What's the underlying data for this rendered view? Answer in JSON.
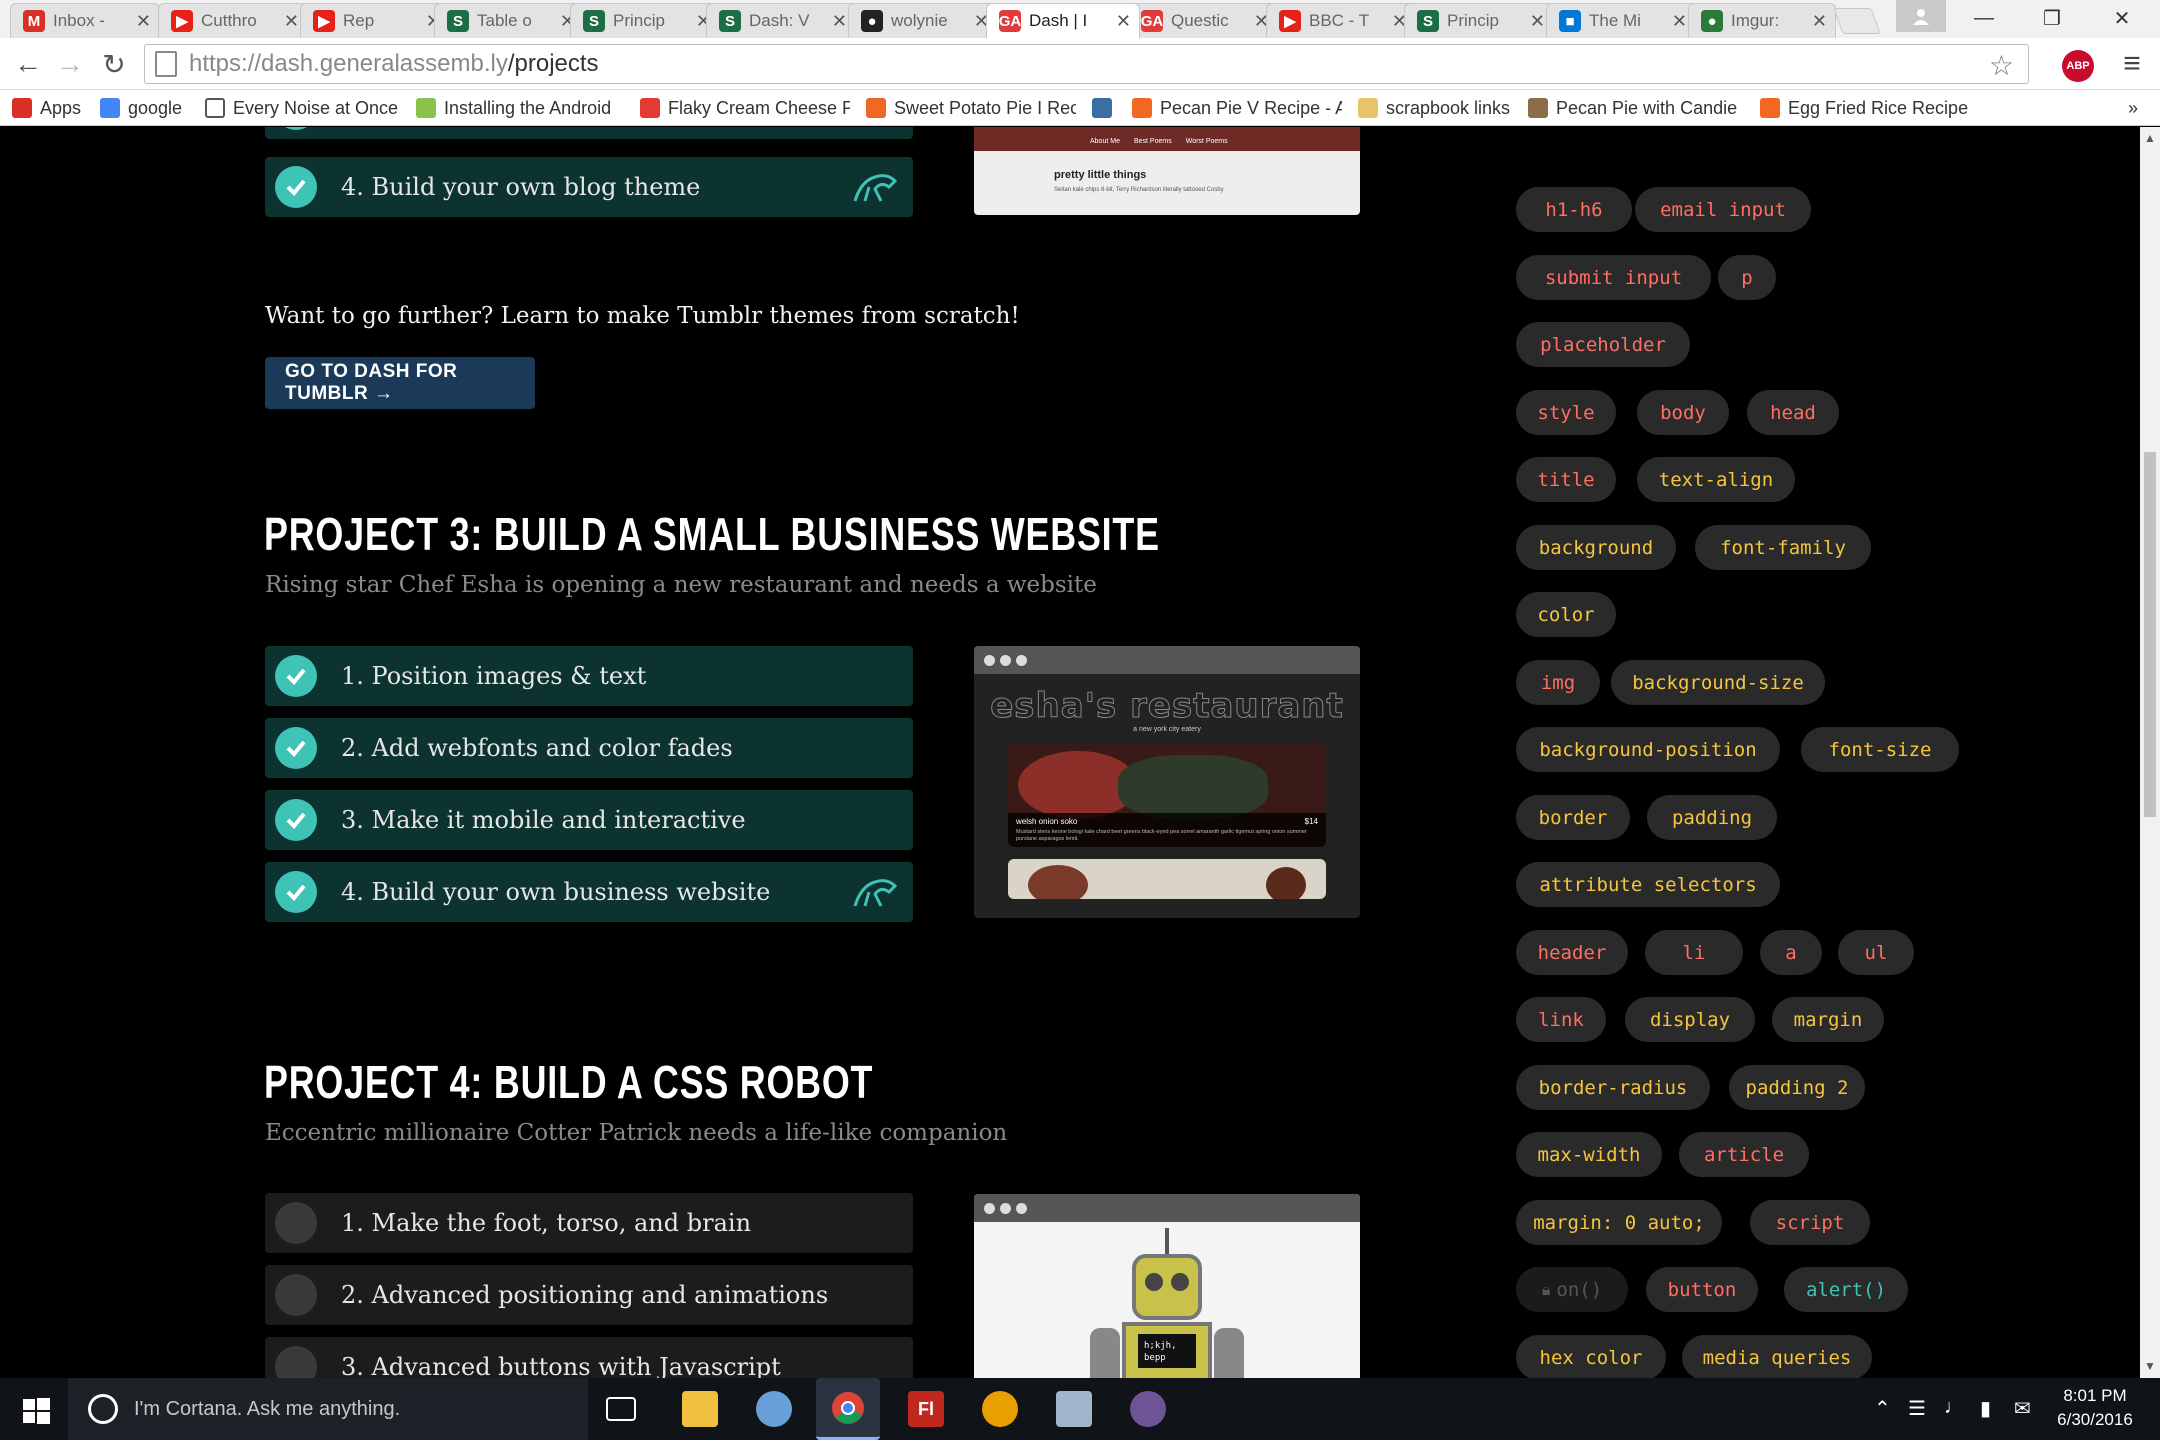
{
  "browser": {
    "tabs": [
      {
        "title": "Inbox -",
        "icon": "gmail-icon",
        "color": "#d93025",
        "glyph": "M"
      },
      {
        "title": "Cutthro",
        "icon": "youtube-icon",
        "color": "#e62117",
        "glyph": "▶"
      },
      {
        "title": "Rep",
        "icon": "youtube-icon",
        "color": "#e62117",
        "glyph": "▶"
      },
      {
        "title": "Table o",
        "icon": "sheets-icon",
        "color": "#1e6e45",
        "glyph": "S"
      },
      {
        "title": "Princip",
        "icon": "sheets-icon",
        "color": "#1e6e45",
        "glyph": "S"
      },
      {
        "title": "Dash: V",
        "icon": "sheets-icon",
        "color": "#1e6e45",
        "glyph": "S"
      },
      {
        "title": "wolynie",
        "icon": "github-icon",
        "color": "#222222",
        "glyph": "●"
      },
      {
        "title": "Dash | I",
        "icon": "ga-icon",
        "color": "#e23b3b",
        "glyph": "GA",
        "active": true
      },
      {
        "title": "Questic",
        "icon": "ga-icon",
        "color": "#e23b3b",
        "glyph": "GA"
      },
      {
        "title": "BBC - T",
        "icon": "youtube-icon",
        "color": "#e62117",
        "glyph": "▶"
      },
      {
        "title": "Princip",
        "icon": "sheets-icon",
        "color": "#1e6e45",
        "glyph": "S"
      },
      {
        "title": "The Mi",
        "icon": "windows-icon",
        "color": "#0078d7",
        "glyph": "■"
      },
      {
        "title": "Imgur:",
        "icon": "imgur-icon",
        "color": "#2b7a3a",
        "glyph": "●"
      }
    ],
    "url_host": "https://dash.generalassemb.ly",
    "url_path": "/projects",
    "bookmarks": [
      {
        "label": "Apps",
        "icon": "apps-grid-icon",
        "color": "#d93025"
      },
      {
        "label": "google",
        "icon": "google-icon",
        "color": "#4285f4"
      },
      {
        "label": "Every Noise at Once",
        "icon": "page-icon",
        "color": "#ffffff"
      },
      {
        "label": "Installing the Android",
        "icon": "android-icon",
        "color": "#8bc34a"
      },
      {
        "label": "Flaky Cream Cheese P",
        "icon": "bookmark-red-icon",
        "color": "#e53935"
      },
      {
        "label": "Sweet Potato Pie I Rec",
        "icon": "allrecipes-icon",
        "color": "#f26722"
      },
      {
        "label": "",
        "icon": "bird-icon",
        "color": "#3b6ea5"
      },
      {
        "label": "Pecan Pie V Recipe - A",
        "icon": "allrecipes-icon",
        "color": "#f26722"
      },
      {
        "label": "scrapbook links",
        "icon": "folder-icon",
        "color": "#e8c36a"
      },
      {
        "label": "Pecan Pie with Candie",
        "icon": "photo-icon",
        "color": "#8b6d4a"
      },
      {
        "label": "Egg Fried Rice Recipe",
        "icon": "allrecipes-icon",
        "color": "#f26722"
      }
    ]
  },
  "page": {
    "project2": {
      "step4": "4. Build your own blog theme",
      "preview_heading": "pretty little things",
      "preview_line": "Seitan kale chips 8-bit, Terry Richardson literally tattooed Cosby",
      "preview_nav": [
        "About Me",
        "Best Poems",
        "Worst Poems"
      ],
      "further_text": "Want to go further? Learn to make Tumblr themes from scratch!",
      "button": "GO TO DASH FOR TUMBLR →"
    },
    "project3": {
      "title": "PROJECT 3: BUILD A SMALL BUSINESS WEBSITE",
      "subtitle": "Rising star Chef Esha is opening a new restaurant and needs a website",
      "steps": [
        "1. Position images & text",
        "2. Add webfonts and color fades",
        "3. Make it mobile and interactive",
        "4. Build your own business website"
      ],
      "preview_title": "esha's restaurant",
      "preview_tagline": "a new york city eatery",
      "dish_name": "welsh onion soko",
      "dish_price": "$14",
      "dish_desc": "Mustard slens keone bologi kale chard beet greens black-eyed pea sorrel amaranth garlic tigernut spring onion summer purslane asparagus lentil."
    },
    "project4": {
      "title": "PROJECT 4: BUILD A CSS ROBOT",
      "subtitle": "Eccentric millionaire Cotter Patrick needs a life-like companion",
      "steps": [
        "1. Make the foot, torso, and brain",
        "2. Advanced positioning and animations",
        "3. Advanced buttons with Javascript"
      ],
      "robot_screen": "h;kjh,\nbepp"
    },
    "tags": [
      {
        "label": "h1-h6",
        "kind": "html"
      },
      {
        "label": "email input",
        "kind": "html"
      },
      {
        "label": "submit input",
        "kind": "html"
      },
      {
        "label": "p",
        "kind": "html"
      },
      {
        "label": "placeholder",
        "kind": "html"
      },
      {
        "label": "style",
        "kind": "html"
      },
      {
        "label": "body",
        "kind": "html"
      },
      {
        "label": "head",
        "kind": "html"
      },
      {
        "label": "title",
        "kind": "html"
      },
      {
        "label": "text-align",
        "kind": "css"
      },
      {
        "label": "background",
        "kind": "css"
      },
      {
        "label": "font-family",
        "kind": "css"
      },
      {
        "label": "color",
        "kind": "css"
      },
      {
        "label": "img",
        "kind": "html"
      },
      {
        "label": "background-size",
        "kind": "css"
      },
      {
        "label": "background-position",
        "kind": "css"
      },
      {
        "label": "font-size",
        "kind": "css"
      },
      {
        "label": "border",
        "kind": "css"
      },
      {
        "label": "padding",
        "kind": "css"
      },
      {
        "label": "attribute selectors",
        "kind": "css"
      },
      {
        "label": "header",
        "kind": "html"
      },
      {
        "label": "li",
        "kind": "html"
      },
      {
        "label": "a",
        "kind": "html"
      },
      {
        "label": "ul",
        "kind": "html"
      },
      {
        "label": "link",
        "kind": "html"
      },
      {
        "label": "display",
        "kind": "css"
      },
      {
        "label": "margin",
        "kind": "css"
      },
      {
        "label": "border-radius",
        "kind": "css"
      },
      {
        "label": "padding 2",
        "kind": "css"
      },
      {
        "label": "max-width",
        "kind": "css"
      },
      {
        "label": "article",
        "kind": "html"
      },
      {
        "label": "margin: 0 auto;",
        "kind": "css"
      },
      {
        "label": "script",
        "kind": "html"
      },
      {
        "label": "on()",
        "kind": "locked"
      },
      {
        "label": "button",
        "kind": "html"
      },
      {
        "label": "alert()",
        "kind": "js"
      },
      {
        "label": "hex color",
        "kind": "css"
      },
      {
        "label": "media queries",
        "kind": "css"
      }
    ],
    "colors": {
      "html": "#ff6e63",
      "css": "#f4c53d",
      "js": "#3fc3b6",
      "done": "#0c3330"
    }
  },
  "taskbar": {
    "search_placeholder": "I'm Cortana. Ask me anything.",
    "time": "8:01 PM",
    "date": "6/30/2016",
    "apps": [
      "task-view-icon",
      "file-explorer-icon",
      "paint-icon",
      "chrome-icon",
      "flash-icon",
      "game-icon",
      "photos-icon",
      "github-desktop-icon"
    ]
  }
}
